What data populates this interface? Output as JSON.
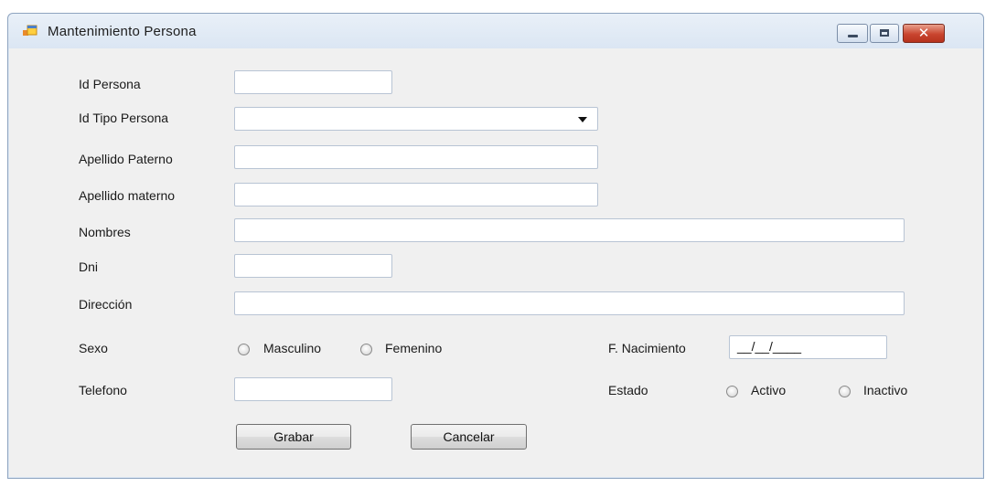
{
  "window": {
    "title": "Mantenimiento Persona",
    "controls": {
      "minimize_icon": "minimize-icon",
      "maximize_icon": "maximize-icon",
      "close_glyph": "✕"
    }
  },
  "form": {
    "id_persona": {
      "label": "Id Persona",
      "value": ""
    },
    "id_tipo_persona": {
      "label": "Id Tipo Persona",
      "value": ""
    },
    "apellido_paterno": {
      "label": "Apellido Paterno",
      "value": ""
    },
    "apellido_materno": {
      "label": "Apellido materno",
      "value": ""
    },
    "nombres": {
      "label": "Nombres",
      "value": ""
    },
    "dni": {
      "label": "Dni",
      "value": ""
    },
    "direccion": {
      "label": "Dirección",
      "value": ""
    },
    "sexo": {
      "label": "Sexo",
      "options": [
        "Masculino",
        "Femenino"
      ],
      "selected": null
    },
    "fecha_nacimiento": {
      "label": "F. Nacimiento",
      "mask": "__/__/____"
    },
    "telefono": {
      "label": "Telefono",
      "value": ""
    },
    "estado": {
      "label": "Estado",
      "options": [
        "Activo",
        "Inactivo"
      ],
      "selected": null
    }
  },
  "buttons": {
    "grabar": "Grabar",
    "cancelar": "Cancelar"
  },
  "colors": {
    "window_frame": "#dfe9f5",
    "client": "#f0f0f0",
    "close_button": "#c9452f"
  }
}
